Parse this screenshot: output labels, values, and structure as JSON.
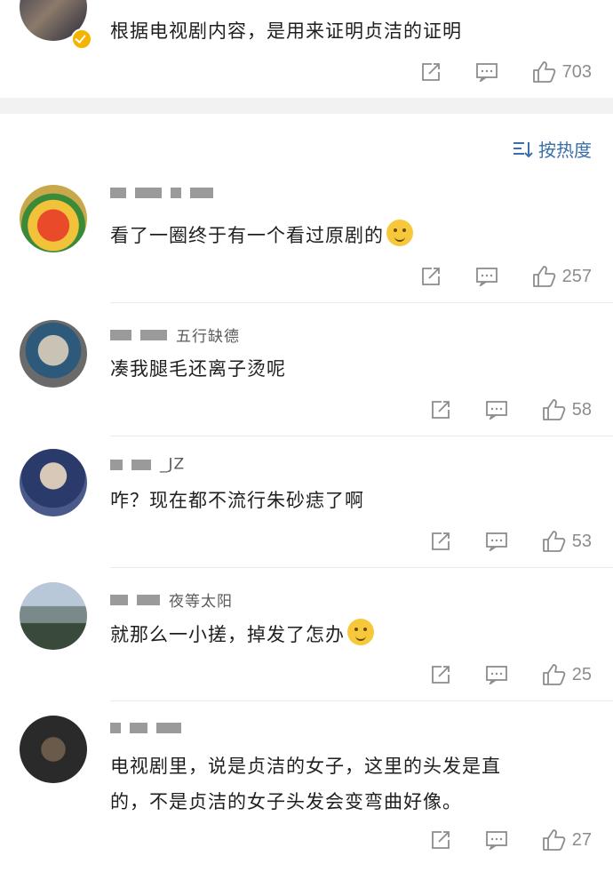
{
  "top_comment": {
    "text": "根据电视剧内容，是用来证明贞洁的证明",
    "likes": "703"
  },
  "sort_label": "按热度",
  "comments": [
    {
      "name_tail": "",
      "text": "看了一圈终于有一个看过原剧的",
      "likes": "257",
      "emoji": "laughing-crying-emoji"
    },
    {
      "name_tail": "五行缺德",
      "text": "凑我腿毛还离子烫呢",
      "likes": "58"
    },
    {
      "name_tail": "_JZ",
      "text": "咋？现在都不流行朱砂痣了啊",
      "likes": "53"
    },
    {
      "name_tail": "夜等太阳",
      "text": "就那么一小搓，掉发了怎办",
      "likes": "25",
      "emoji": "thinking-emoji"
    },
    {
      "name_tail": "",
      "text_line1": "电视剧里，说是贞洁的女子，这里的头发是直",
      "text_line2": "的，不是贞洁的女子头发会变弯曲好像。",
      "likes": "27"
    }
  ],
  "colors": {
    "accent": "#3a6fa8",
    "icon": "#8c8c8c",
    "badge": "#f5b400"
  }
}
